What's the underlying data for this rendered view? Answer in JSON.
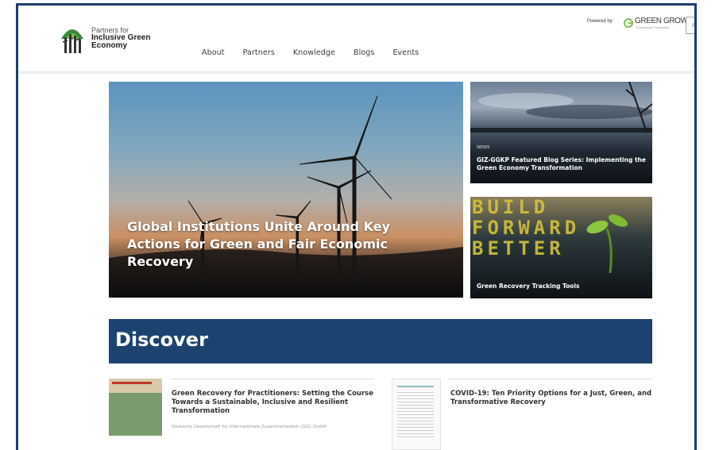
{
  "header": {
    "logo": {
      "line1": "Partners for",
      "line2": "Inclusive Green",
      "line3": "Economy"
    },
    "nav": [
      "About",
      "Partners",
      "Knowledge",
      "Blogs",
      "Events"
    ],
    "powered_by": "Powered by:",
    "partner": {
      "name": "GREEN GROWTH",
      "tagline": "Knowledge Partnership"
    },
    "language_icon": "translate-icon"
  },
  "hero": {
    "title": "Global Institutions Unite Around Key Actions for Green and Fair Economic Recovery"
  },
  "cards": [
    {
      "tag": "NEWS",
      "title": "GIZ-GGKP Featured Blog Series: Implementing the Green Economy Transformation"
    },
    {
      "overlay_text": [
        "BUILD",
        "FORWARD",
        "BETTER"
      ],
      "title": "Green Recovery Tracking Tools"
    }
  ],
  "discover": {
    "heading": "Discover",
    "items": [
      {
        "title": "Green Recovery for Practitioners: Setting the Course Towards a Sustainable, Inclusive and Resilient Transformation",
        "publisher": "Deutsche Gesellschaft für Internationale Zusammenarbeit (GIZ) GmbH"
      },
      {
        "title": "COVID-19: Ten Priority Options for a Just, Green, and Transformative Recovery"
      }
    ]
  },
  "colors": {
    "frame": "#1f3f6d",
    "discover_bg": "#1c4370",
    "brand_green": "#3c8b3a"
  }
}
